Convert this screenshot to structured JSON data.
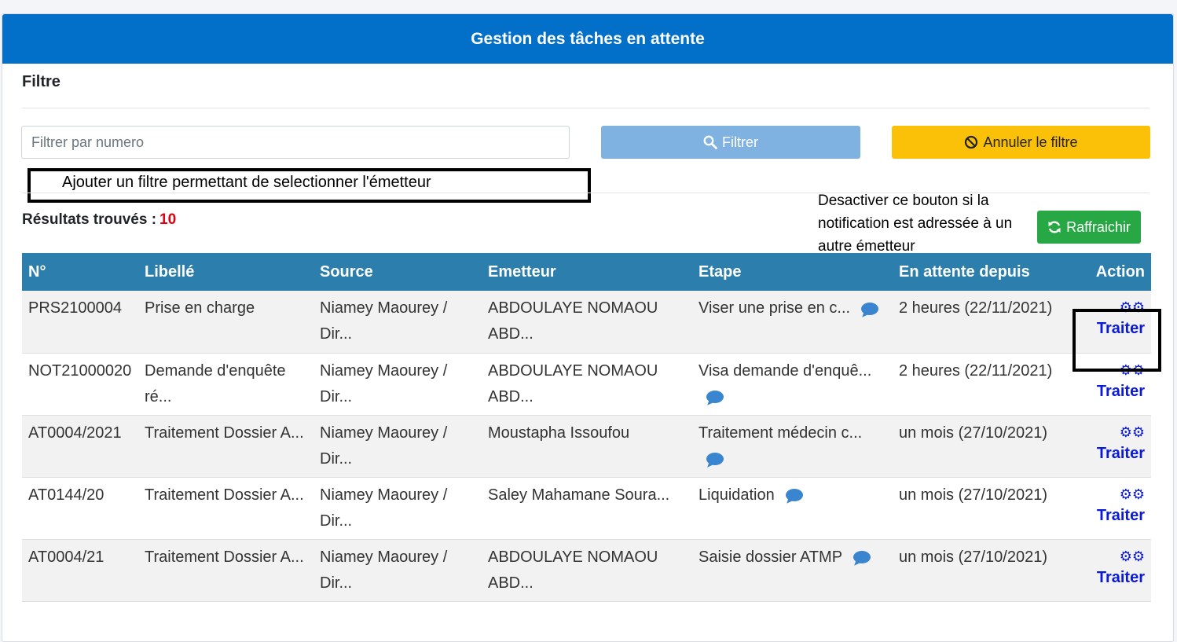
{
  "header": {
    "title": "Gestion des tâches en attente"
  },
  "filter": {
    "title": "Filtre",
    "search_placeholder": "Filtrer par numero",
    "filter_button": "Filtrer",
    "cancel_button": "Annuler le filtre"
  },
  "annotations": {
    "emitter_filter_note": "Ajouter un filtre permettant de selectionner l'émetteur",
    "refresh_note": "Desactiver ce bouton si la notification est adressée à un autre émetteur"
  },
  "results": {
    "label": "Résultats trouvés :",
    "count": "10"
  },
  "refresh_button": "Raffraichir",
  "table": {
    "headers": [
      "N°",
      "Libellé",
      "Source",
      "Emetteur",
      "Etape",
      "En attente depuis",
      "Action"
    ],
    "action_label": "Traiter",
    "rows": [
      {
        "no": "PRS2100004",
        "libelle": "Prise en charge",
        "source": "Niamey Maourey / Dir...",
        "emetteur": "ABDOULAYE NOMAOU ABD...",
        "etape": "Viser une prise en c...",
        "attente": "2 heures (22/11/2021)"
      },
      {
        "no": "NOT21000020",
        "libelle": "Demande d'enquête ré...",
        "source": "Niamey Maourey / Dir...",
        "emetteur": "ABDOULAYE NOMAOU ABD...",
        "etape": "Visa demande d'enquê...",
        "attente": "2 heures (22/11/2021)"
      },
      {
        "no": "AT0004/2021",
        "libelle": "Traitement Dossier A...",
        "source": "Niamey Maourey / Dir...",
        "emetteur": "Moustapha Issoufou",
        "etape": "Traitement médecin c...",
        "attente": "un mois (27/10/2021)"
      },
      {
        "no": "AT0144/20",
        "libelle": "Traitement Dossier A...",
        "source": "Niamey Maourey / Dir...",
        "emetteur": "Saley Mahamane Soura...",
        "etape": "Liquidation",
        "attente": "un mois (27/10/2021)"
      },
      {
        "no": "AT0004/21",
        "libelle": "Traitement Dossier A...",
        "source": "Niamey Maourey / Dir...",
        "emetteur": "ABDOULAYE NOMAOU ABD...",
        "etape": "Saisie dossier ATMP",
        "attente": "un mois (27/10/2021)"
      }
    ]
  },
  "colors": {
    "header_bg": "#0270c9",
    "table_header_bg": "#2c7fac",
    "filter_btn": "#80b2e1",
    "cancel_btn": "#fbc108",
    "refresh_btn": "#28a745",
    "count_red": "#e0000f",
    "action_blue": "#0a1ad8"
  }
}
